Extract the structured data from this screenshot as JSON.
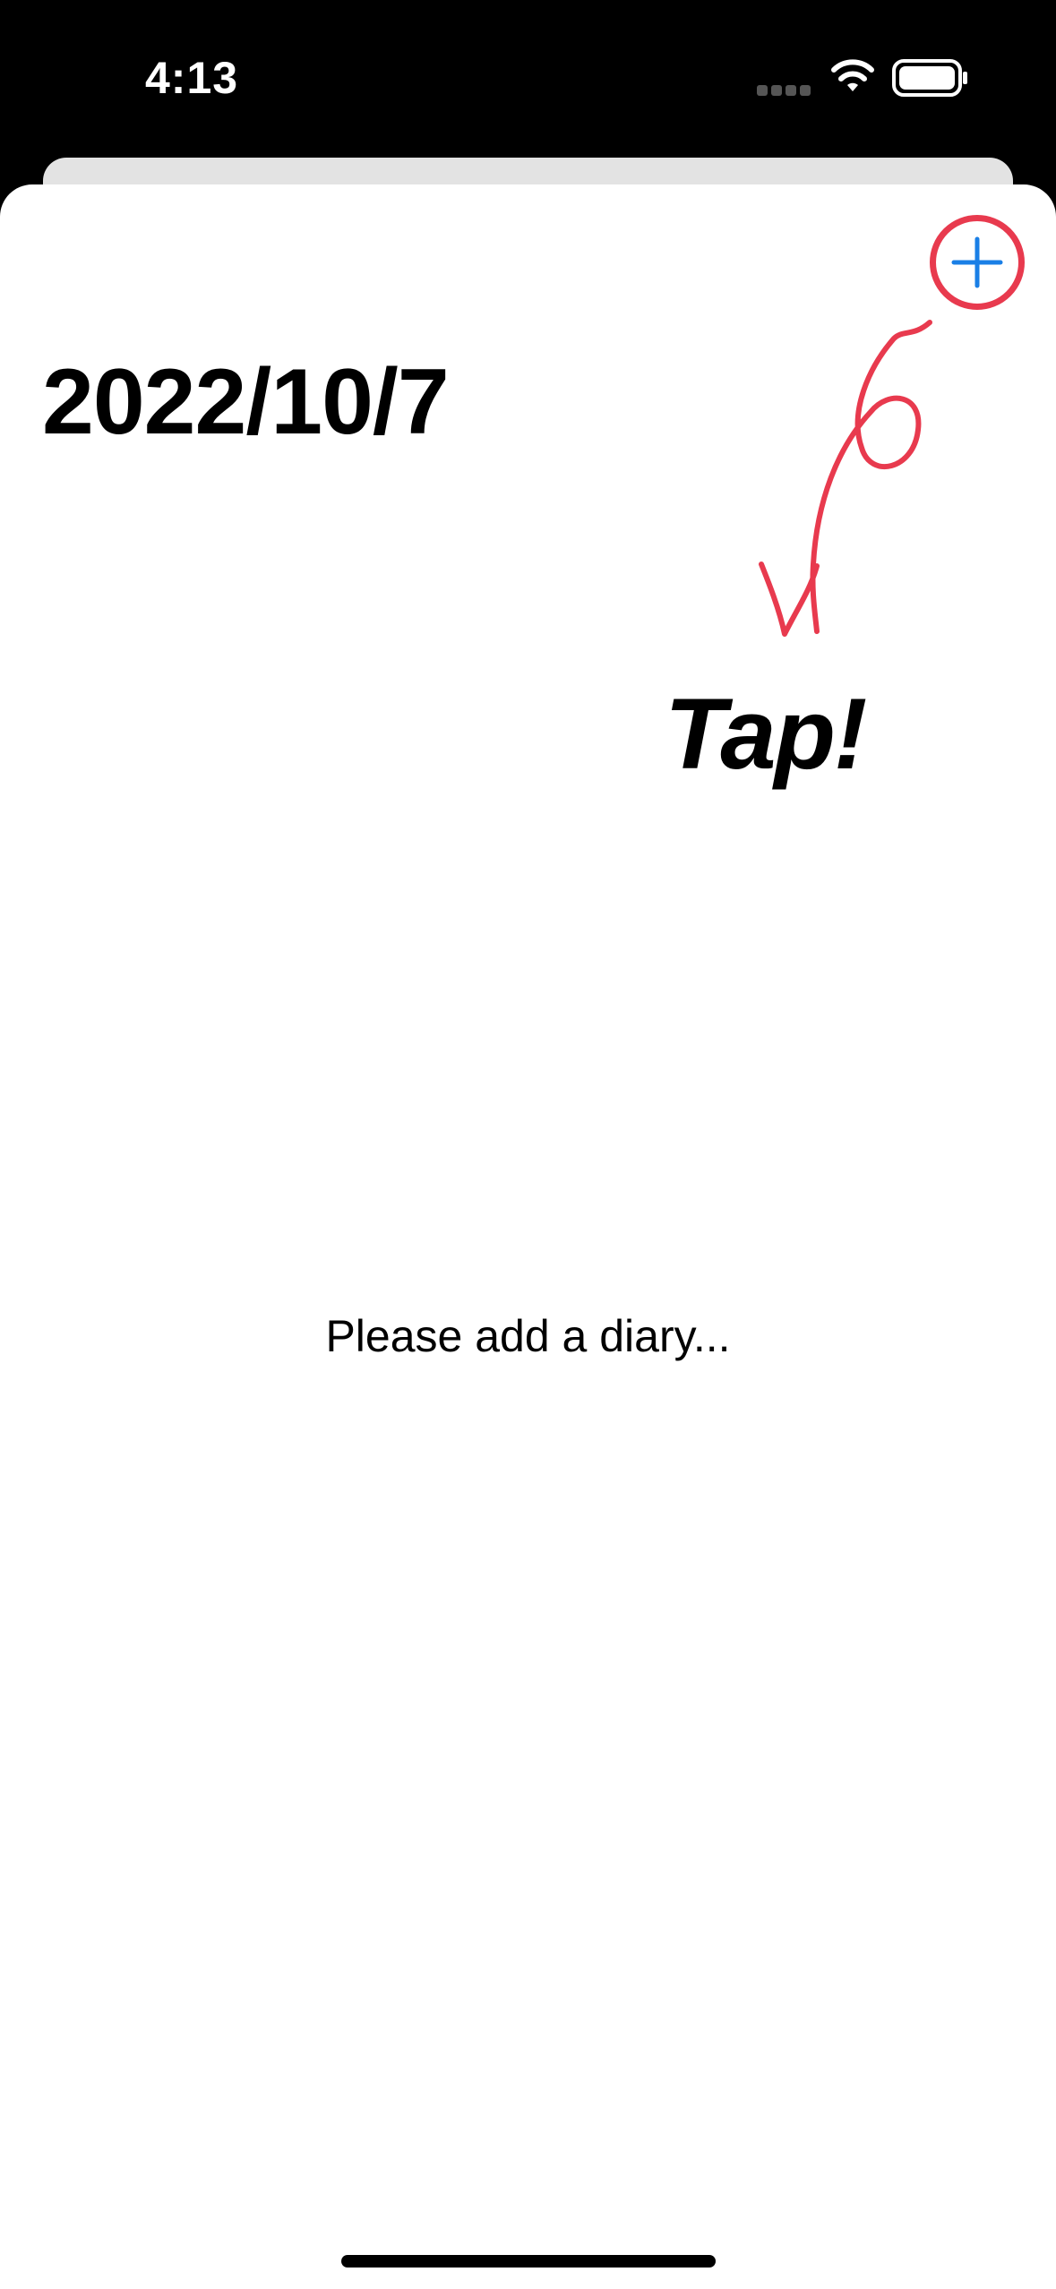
{
  "status_bar": {
    "time": "4:13",
    "icons": [
      "signal-dots-icon",
      "wifi-icon",
      "battery-icon"
    ]
  },
  "header": {
    "date_title": "2022/10/7",
    "add_button_icon": "plus-icon"
  },
  "annotation": {
    "tap_label": "Tap!",
    "arrow_icon": "hand-drawn-arrow-icon",
    "highlight_color": "#e83a4e"
  },
  "main": {
    "empty_message": "Please add a diary..."
  },
  "colors": {
    "accent": "#1a7fe6",
    "annotation": "#e83a4e",
    "background": "#ffffff",
    "status_bar": "#000000"
  }
}
